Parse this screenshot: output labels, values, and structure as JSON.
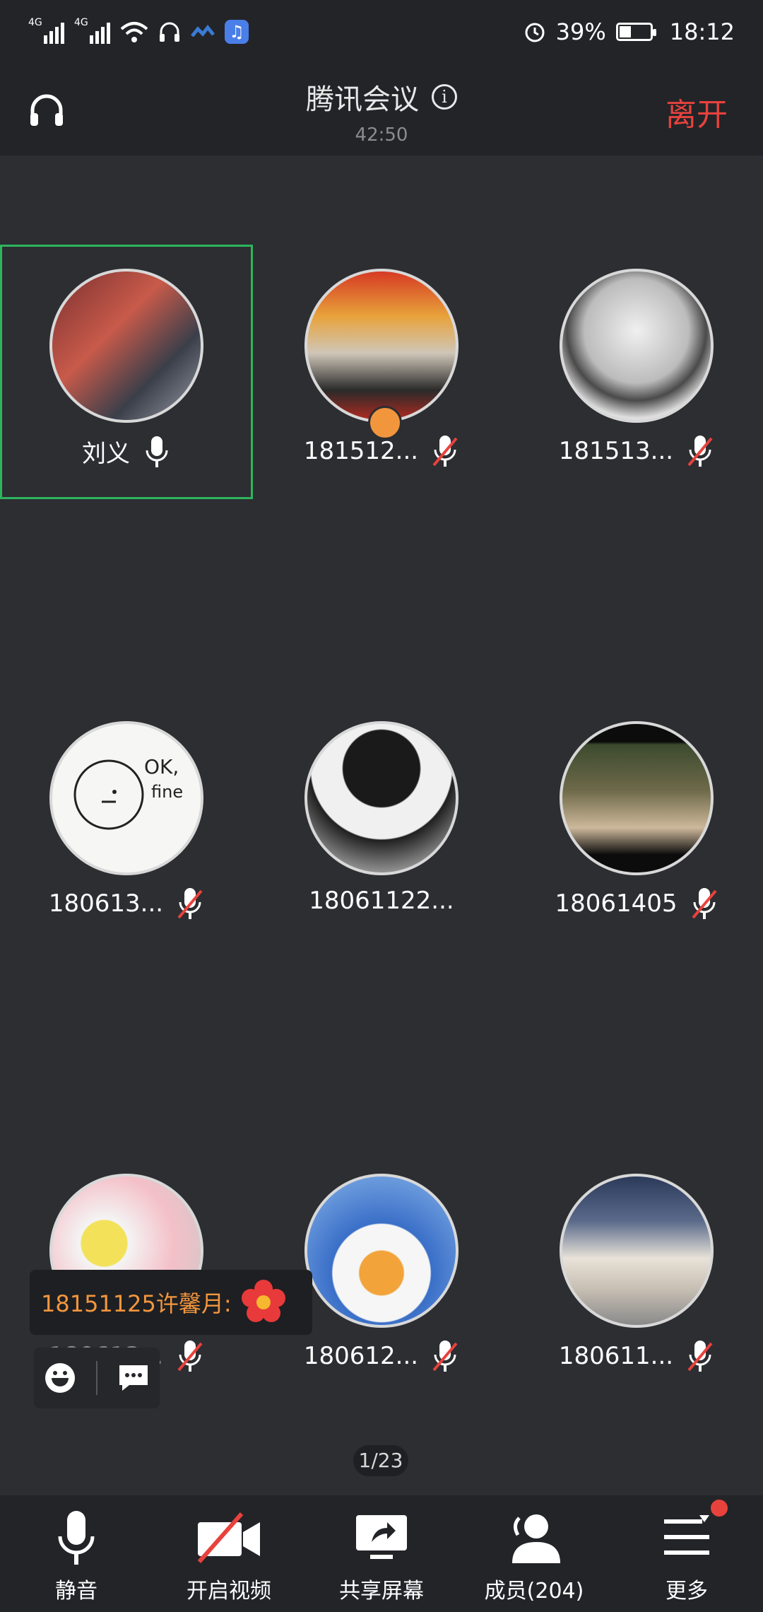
{
  "status_bar": {
    "network_1": "4G",
    "network_2": "4G",
    "battery": "39%",
    "battery_level": 0.39,
    "time": "18:12"
  },
  "header": {
    "title": "腾讯会议",
    "timer": "42:50",
    "leave_label": "离开"
  },
  "participants": [
    {
      "name": "刘义",
      "mic": "on",
      "active": true
    },
    {
      "name": "181512...",
      "mic": "muted",
      "host": true
    },
    {
      "name": "181513...",
      "mic": "muted"
    },
    {
      "name": "180613...",
      "mic": "muted"
    },
    {
      "name": "18061122...",
      "mic": "none"
    },
    {
      "name": "18061405",
      "mic": "muted"
    },
    {
      "name": "180613...",
      "mic": "muted"
    },
    {
      "name": "180612...",
      "mic": "muted"
    },
    {
      "name": "180611...",
      "mic": "muted"
    }
  ],
  "chat_popup": {
    "text": "18151125许馨月:"
  },
  "page_indicator": "1/23",
  "bottom_bar": {
    "mute_label": "静音",
    "video_label": "开启视频",
    "share_label": "共享屏幕",
    "members_label": "成员(204)",
    "more_label": "更多"
  },
  "colors": {
    "background": "#2c2e32",
    "bar": "#232428",
    "leave": "#e8423d",
    "active_border": "#2db55d",
    "chat_text": "#f2963e"
  }
}
